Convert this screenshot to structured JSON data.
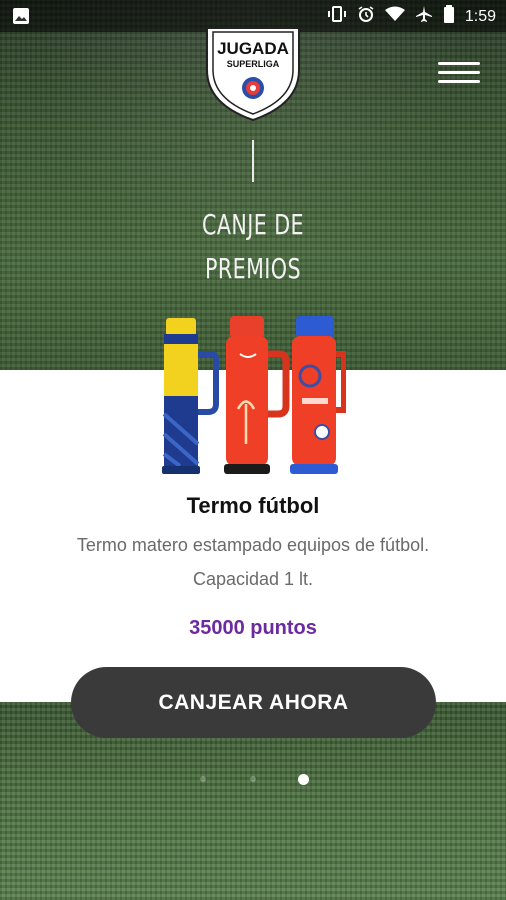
{
  "status_bar": {
    "time": "1:59",
    "icons": [
      "image-icon",
      "vibrate-icon",
      "alarm-icon",
      "wifi-icon",
      "airplane-icon",
      "battery-icon"
    ]
  },
  "header": {
    "logo_text_main": "JUGADA",
    "logo_text_sub": "SUPERLIGA"
  },
  "section": {
    "title_line1": "CANJE DE",
    "title_line2": "PREMIOS"
  },
  "product": {
    "name": "Termo fútbol",
    "description_line1": "Termo matero estampado equipos de fútbol.",
    "description_line2": "Capacidad 1 lt.",
    "points": "35000 puntos"
  },
  "cta": {
    "label": "CANJEAR AHORA"
  },
  "pagination": {
    "count": 3,
    "active": 3
  },
  "colors": {
    "accent_purple": "#6b2aa0",
    "button_dark": "#3a3a3a"
  }
}
